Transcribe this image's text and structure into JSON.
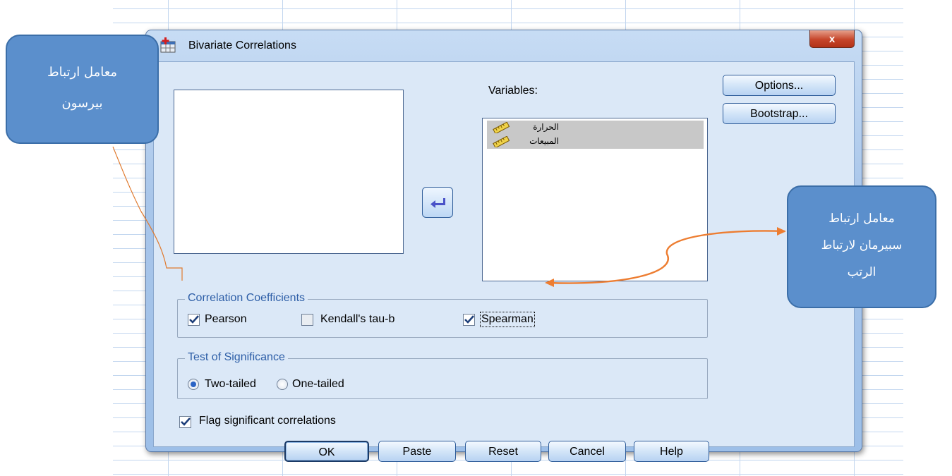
{
  "window": {
    "title": "Bivariate Correlations",
    "close_label": "x"
  },
  "variables": {
    "label": "Variables:",
    "items": [
      "الحرارة",
      "المبيعات"
    ]
  },
  "side_buttons": {
    "options": "Options...",
    "bootstrap": "Bootstrap..."
  },
  "correlation_coefficients": {
    "title": "Correlation Coefficients",
    "pearson": {
      "label": "Pearson",
      "checked": true
    },
    "kendall": {
      "label": "Kendall's tau-b",
      "checked": false
    },
    "spearman": {
      "label": "Spearman",
      "checked": true
    }
  },
  "test_of_significance": {
    "title": "Test of Significance",
    "two_tailed": {
      "label": "Two-tailed",
      "selected": true
    },
    "one_tailed": {
      "label": "One-tailed",
      "selected": false
    }
  },
  "flag": {
    "label": "Flag significant correlations",
    "checked": true
  },
  "footer_buttons": {
    "ok": "OK",
    "paste": "Paste",
    "reset": "Reset",
    "cancel": "Cancel",
    "help": "Help"
  },
  "annotations": {
    "pearson_callout": [
      "معامل ارتباط",
      "بيرسون"
    ],
    "spearman_callout": [
      "معامل ارتباط",
      "سبيرمان لارتباط",
      "الرتب"
    ]
  },
  "colors": {
    "callout_fill": "#5b8fcc",
    "connector_pearson": "#e07a2e",
    "connector_spearman": "#ed7d31",
    "group_title": "#2d5ea7"
  }
}
